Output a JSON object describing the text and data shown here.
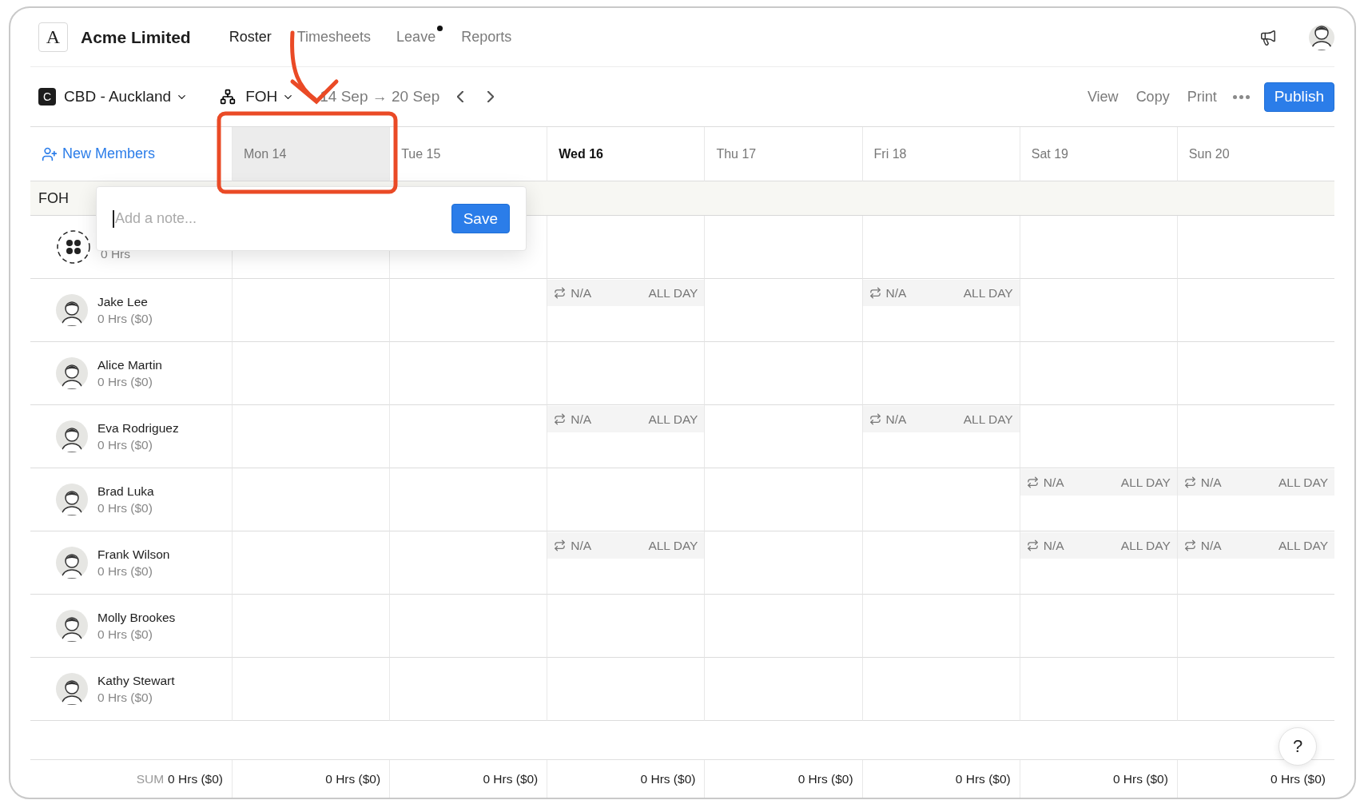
{
  "app": {
    "name": "Acme Limited",
    "logo_letter": "A"
  },
  "nav": [
    {
      "label": "Roster",
      "selected": true,
      "dot": false
    },
    {
      "label": "Timesheets",
      "selected": false,
      "dot": false
    },
    {
      "label": "Leave",
      "selected": false,
      "dot": true
    },
    {
      "label": "Reports",
      "selected": false,
      "dot": false
    }
  ],
  "toolbar": {
    "location_badge": "C",
    "location": "CBD - Auckland",
    "team": "FOH",
    "range": "14 Sep → 20 Sep",
    "actions": [
      "View",
      "Copy",
      "Print"
    ],
    "publish": "Publish"
  },
  "grid": {
    "new_members": "New Members",
    "days": [
      {
        "label": "Mon 14",
        "selected": true,
        "today": false
      },
      {
        "label": "Tue 15",
        "selected": false,
        "today": false
      },
      {
        "label": "Wed 16",
        "selected": false,
        "today": true
      },
      {
        "label": "Thu 17",
        "selected": false,
        "today": false
      },
      {
        "label": "Fri 18",
        "selected": false,
        "today": false
      },
      {
        "label": "Sat 19",
        "selected": false,
        "today": false
      },
      {
        "label": "Sun 20",
        "selected": false,
        "today": false
      }
    ],
    "group": "FOH",
    "rows": [
      {
        "kind": "unassigned",
        "hours": "0 Hrs",
        "cells": [
          {
            "kind": "empty"
          },
          {
            "kind": "empty"
          },
          {
            "kind": "empty"
          },
          {
            "kind": "empty"
          },
          {
            "kind": "empty"
          },
          {
            "kind": "empty"
          },
          {
            "kind": "empty"
          }
        ]
      },
      {
        "kind": "member",
        "name": "Jake Lee",
        "hours": "0 Hrs ($0)",
        "cells": [
          {
            "kind": "empty"
          },
          {
            "kind": "empty"
          },
          {
            "kind": "shift",
            "label": "N/A",
            "time": "ALL DAY"
          },
          {
            "kind": "empty"
          },
          {
            "kind": "shift",
            "label": "N/A",
            "time": "ALL DAY"
          },
          {
            "kind": "empty"
          },
          {
            "kind": "empty"
          }
        ]
      },
      {
        "kind": "member",
        "name": "Alice Martin",
        "hours": "0 Hrs ($0)",
        "cells": [
          {
            "kind": "empty"
          },
          {
            "kind": "empty"
          },
          {
            "kind": "empty"
          },
          {
            "kind": "empty"
          },
          {
            "kind": "empty"
          },
          {
            "kind": "empty"
          },
          {
            "kind": "empty"
          }
        ]
      },
      {
        "kind": "member",
        "name": "Eva Rodriguez",
        "hours": "0 Hrs ($0)",
        "cells": [
          {
            "kind": "empty"
          },
          {
            "kind": "empty"
          },
          {
            "kind": "shift",
            "label": "N/A",
            "time": "ALL DAY"
          },
          {
            "kind": "empty"
          },
          {
            "kind": "shift",
            "label": "N/A",
            "time": "ALL DAY"
          },
          {
            "kind": "empty"
          },
          {
            "kind": "empty"
          }
        ]
      },
      {
        "kind": "member",
        "name": "Brad Luka",
        "hours": "0 Hrs ($0)",
        "cells": [
          {
            "kind": "empty"
          },
          {
            "kind": "empty"
          },
          {
            "kind": "empty"
          },
          {
            "kind": "empty"
          },
          {
            "kind": "empty"
          },
          {
            "kind": "shift",
            "label": "N/A",
            "time": "ALL DAY"
          },
          {
            "kind": "shift",
            "label": "N/A",
            "time": "ALL DAY"
          }
        ]
      },
      {
        "kind": "member",
        "name": "Frank Wilson",
        "hours": "0 Hrs ($0)",
        "cells": [
          {
            "kind": "empty"
          },
          {
            "kind": "empty"
          },
          {
            "kind": "shift",
            "label": "N/A",
            "time": "ALL DAY"
          },
          {
            "kind": "empty"
          },
          {
            "kind": "empty"
          },
          {
            "kind": "shift",
            "label": "N/A",
            "time": "ALL DAY"
          },
          {
            "kind": "shift",
            "label": "N/A",
            "time": "ALL DAY"
          }
        ]
      },
      {
        "kind": "member",
        "name": "Molly Brookes",
        "hours": "0 Hrs ($0)",
        "cells": [
          {
            "kind": "empty"
          },
          {
            "kind": "empty"
          },
          {
            "kind": "empty"
          },
          {
            "kind": "empty"
          },
          {
            "kind": "empty"
          },
          {
            "kind": "empty"
          },
          {
            "kind": "empty"
          }
        ]
      },
      {
        "kind": "member",
        "name": "Kathy Stewart",
        "hours": "0 Hrs ($0)",
        "cells": [
          {
            "kind": "empty"
          },
          {
            "kind": "empty"
          },
          {
            "kind": "empty"
          },
          {
            "kind": "empty"
          },
          {
            "kind": "empty"
          },
          {
            "kind": "empty"
          },
          {
            "kind": "empty"
          }
        ]
      }
    ],
    "sum_label": "SUM",
    "sum_total": "0 Hrs ($0)",
    "day_totals": [
      "0 Hrs ($0)",
      "0 Hrs ($0)",
      "0 Hrs ($0)",
      "0 Hrs ($0)",
      "0 Hrs ($0)",
      "0 Hrs ($0)",
      "0 Hrs ($0)"
    ]
  },
  "note_popover": {
    "placeholder": "Add a note...",
    "button": "Save"
  },
  "help": "?"
}
